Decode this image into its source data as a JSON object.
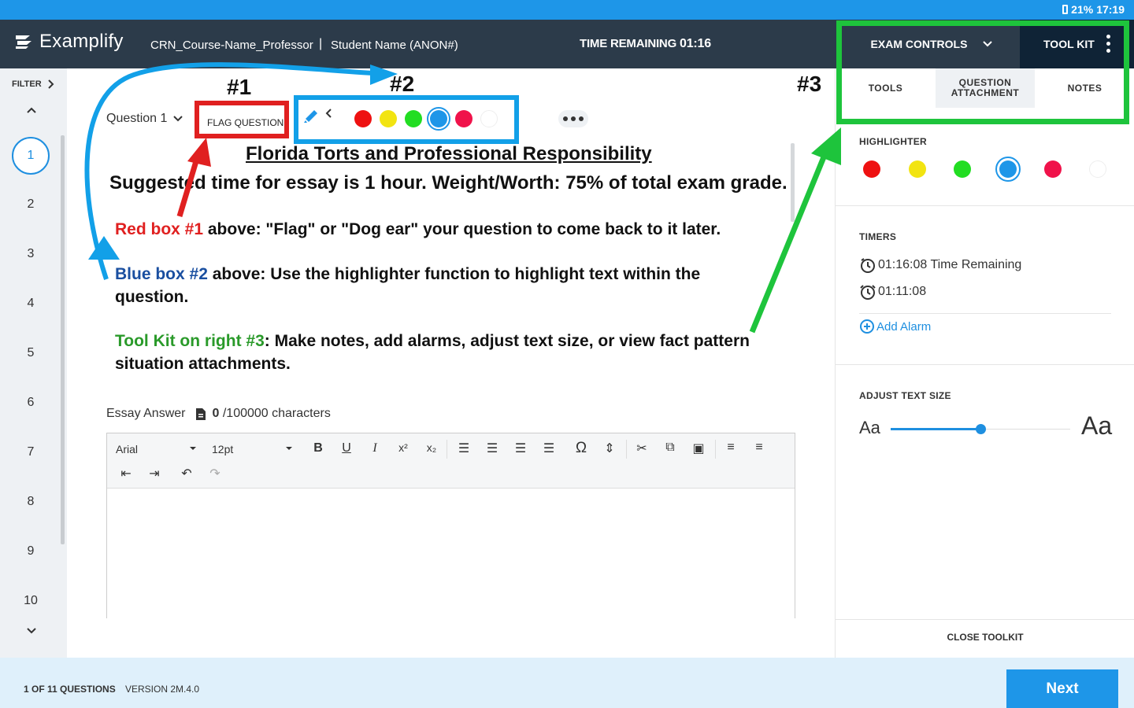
{
  "status_bar": {
    "battery": "21%",
    "time": "17:19"
  },
  "header": {
    "logo": "Examplify",
    "course": "CRN_Course-Name_Professor",
    "separator": "|",
    "student": "Student Name (ANON#)",
    "timer_label": "TIME REMAINING",
    "timer_value": "01:16",
    "exam_controls": "EXAM CONTROLS",
    "tool_kit": "TOOL KIT"
  },
  "left_nav": {
    "filter": "FILTER",
    "questions": [
      "1",
      "2",
      "3",
      "4",
      "5",
      "6",
      "7",
      "8",
      "9",
      "10"
    ],
    "active": "1"
  },
  "question": {
    "selector": "Question 1",
    "flag_button": "FLAG QUESTION",
    "highlight_colors": [
      "#ee1111",
      "#f2e411",
      "#22dd22",
      "#1e96e8",
      "#f0124a",
      "#ffffff"
    ],
    "title": "Florida Torts and Professional Responsibility",
    "subtitle": "Suggested time for essay is 1 hour. Weight/Worth: 75% of total exam grade.",
    "p1_colored": "Red box #1",
    "p1_text": " above: \"Flag\" or \"Dog ear\" your question to come back to it later.",
    "p2_colored": "Blue box #2",
    "p2_text": " above: Use the highlighter function to highlight text within the question.",
    "p3_colored": "Tool Kit on right #3",
    "p3_text": ": Make notes, add alarms, adjust text size, or view fact pattern situation attachments."
  },
  "annotations": {
    "a1": "#1",
    "a2": "#2",
    "a3": "#3"
  },
  "essay": {
    "label": "Essay Answer",
    "char_count": "0",
    "char_limit": "/100000 characters",
    "font": "Arial",
    "size": "12pt"
  },
  "toolkit": {
    "tabs": [
      "TOOLS",
      "QUESTION ATTACHMENT",
      "NOTES"
    ],
    "highlighter_label": "HIGHLIGHTER",
    "timers_label": "TIMERS",
    "timer_remaining": "01:16:08 Time Remaining",
    "alarm_time": "01:11:08",
    "add_alarm": "Add Alarm",
    "text_size_label": "ADJUST TEXT SIZE",
    "text_small": "Aa",
    "text_large": "Aa",
    "text_size_level": 0.5,
    "close": "CLOSE TOOLKIT"
  },
  "footer": {
    "count": "1 OF 11 QUESTIONS",
    "version": "VERSION 2M.4.0",
    "next": "Next"
  }
}
